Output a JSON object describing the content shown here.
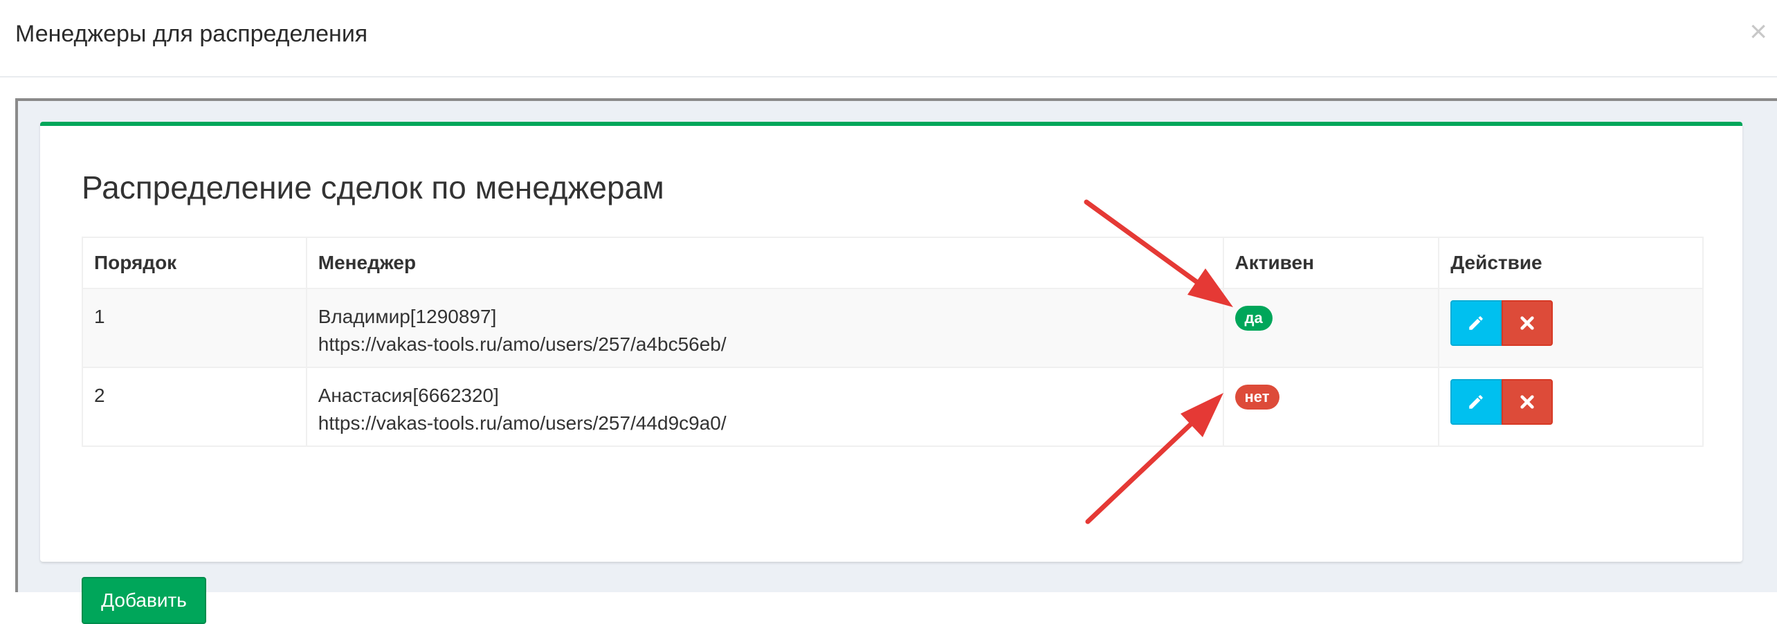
{
  "modal": {
    "title": "Менеджеры для распределения",
    "close_label": "×"
  },
  "panel": {
    "title": "Распределение сделок по менеджерам",
    "columns": [
      "Порядок",
      "Менеджер",
      "Активен",
      "Действие"
    ],
    "rows": [
      {
        "order": "1",
        "manager_name": "Владимир[1290897]",
        "manager_url": "https://vakas-tools.ru/amo/users/257/a4bc56eb/",
        "active": "да",
        "active_state": "yes"
      },
      {
        "order": "2",
        "manager_name": "Анастасия[6662320]",
        "manager_url": "https://vakas-tools.ru/amo/users/257/44d9c9a0/",
        "active": "нет",
        "active_state": "no"
      }
    ],
    "add_button": "Добавить"
  },
  "icons": {
    "edit": "pencil-icon",
    "delete": "times-icon"
  },
  "colors": {
    "accent_green": "#00a65a",
    "badge_red": "#dd4b39",
    "edit_blue": "#00c0ef",
    "annotation_arrow": "#e53935"
  }
}
